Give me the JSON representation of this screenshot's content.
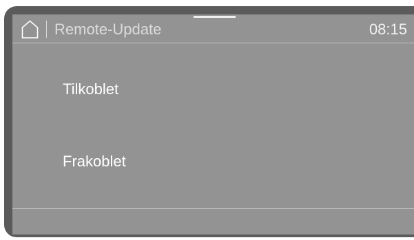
{
  "header": {
    "title": "Remote-Update",
    "time": "08:15",
    "home_icon": "home-icon"
  },
  "options": [
    {
      "label": "Tilkoblet"
    },
    {
      "label": "Frakoblet"
    }
  ],
  "colors": {
    "screen_background": "#939393",
    "bezel": "#5b5b5b",
    "text": "#ffffff",
    "title_text": "#dcdcdc",
    "divider": "#c6c6c6"
  }
}
